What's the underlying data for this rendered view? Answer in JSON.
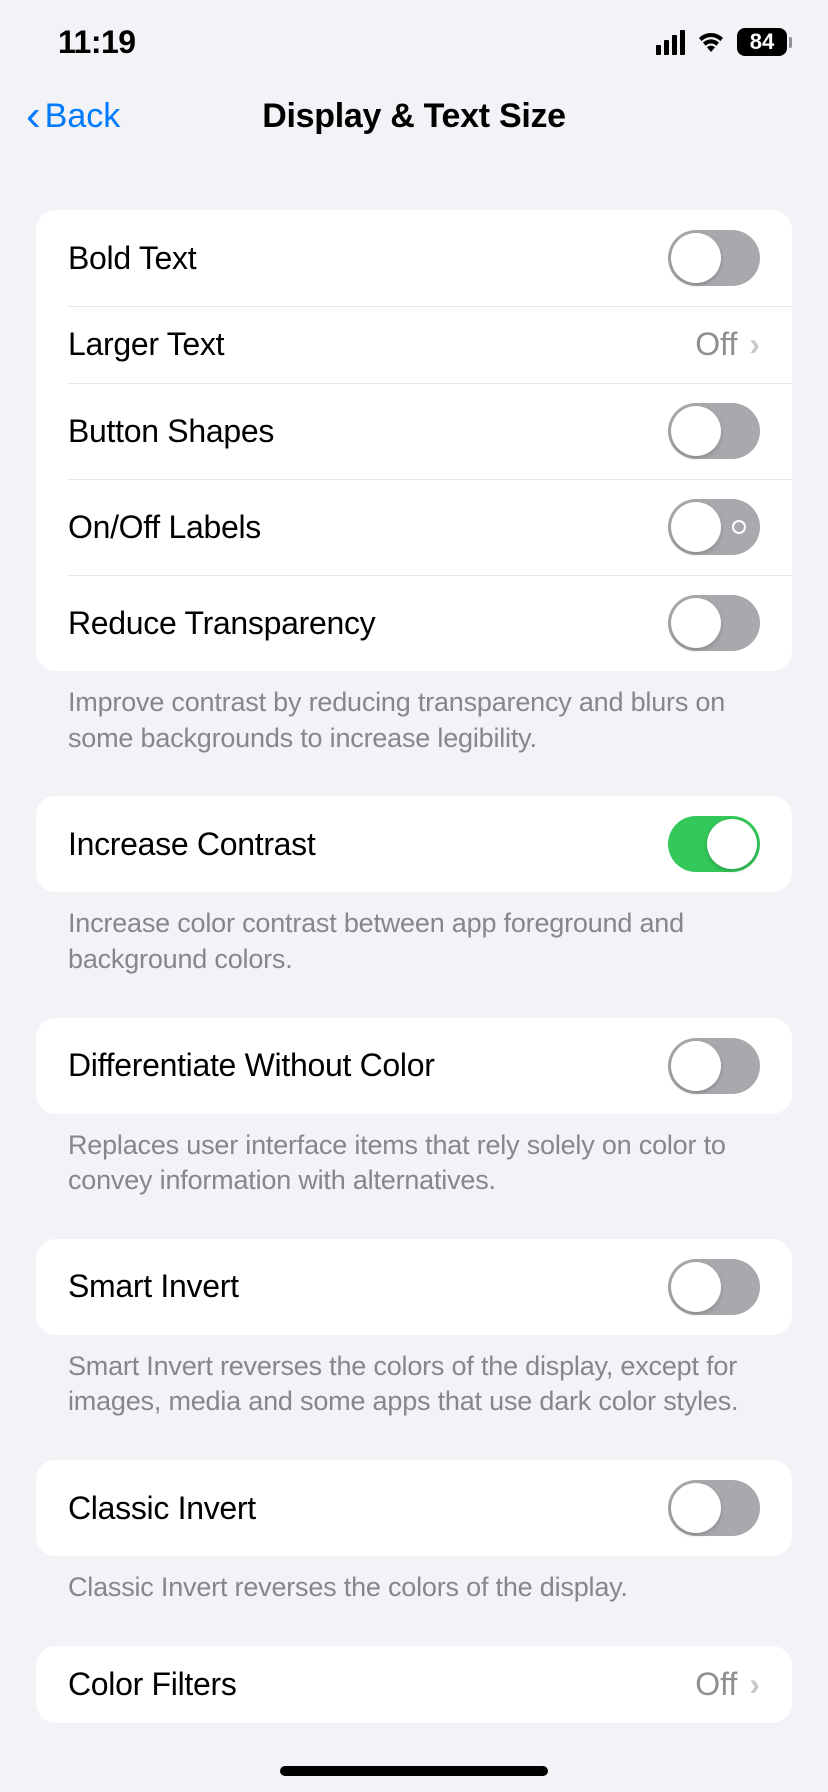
{
  "statusBar": {
    "time": "11:19",
    "battery": "84"
  },
  "nav": {
    "back": "Back",
    "title": "Display & Text Size"
  },
  "groups": [
    {
      "rows": {
        "boldText": "Bold Text",
        "largerText": "Larger Text",
        "largerTextValue": "Off",
        "buttonShapes": "Button Shapes",
        "onOffLabels": "On/Off Labels",
        "reduceTransparency": "Reduce Transparency"
      },
      "footer": "Improve contrast by reducing transparency and blurs on some backgrounds to increase legibility."
    },
    {
      "rows": {
        "increaseContrast": "Increase Contrast"
      },
      "footer": "Increase color contrast between app foreground and background colors."
    },
    {
      "rows": {
        "differentiateWithoutColor": "Differentiate Without Color"
      },
      "footer": "Replaces user interface items that rely solely on color to convey information with alternatives."
    },
    {
      "rows": {
        "smartInvert": "Smart Invert"
      },
      "footer": "Smart Invert reverses the colors of the display, except for images, media and some apps that use dark color styles."
    },
    {
      "rows": {
        "classicInvert": "Classic Invert"
      },
      "footer": "Classic Invert reverses the colors of the display."
    },
    {
      "rows": {
        "colorFilters": "Color Filters",
        "colorFiltersValue": "Off"
      }
    }
  ]
}
